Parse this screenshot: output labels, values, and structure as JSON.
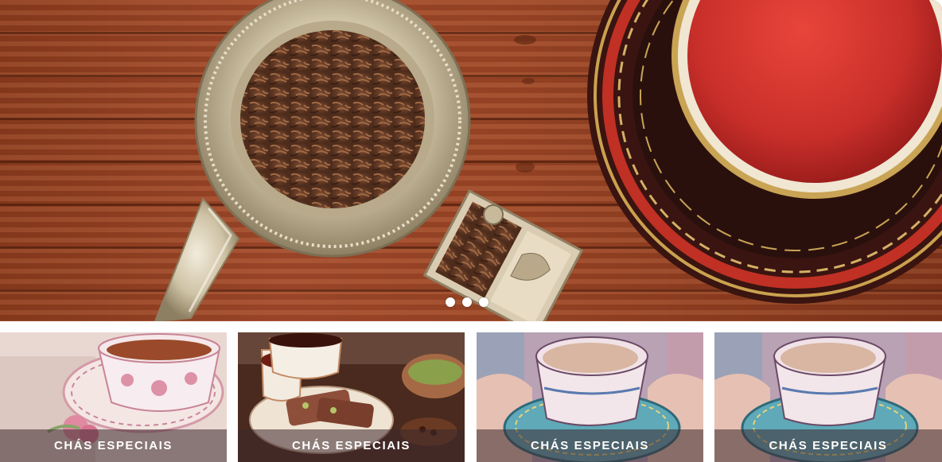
{
  "hero": {
    "slides_count": 3,
    "active_slide": 1,
    "dot_labels": [
      "slide 1",
      "slide 2",
      "slide 3"
    ]
  },
  "tiles": [
    {
      "caption": "CHÁS ESPECIAIS",
      "image": "pink-floral-teacup"
    },
    {
      "caption": "CHÁS ESPECIAIS",
      "image": "tea-cups-and-biscotti"
    },
    {
      "caption": "CHÁS ESPECIAIS",
      "image": "milk-tea-cup-in-hands"
    },
    {
      "caption": "CHÁS ESPECIAIS",
      "image": "milk-tea-cup-in-hands"
    }
  ],
  "colors": {
    "wood": "#9a4425",
    "tea_red": "#d43a30",
    "caption_overlay": "#3c282d"
  }
}
